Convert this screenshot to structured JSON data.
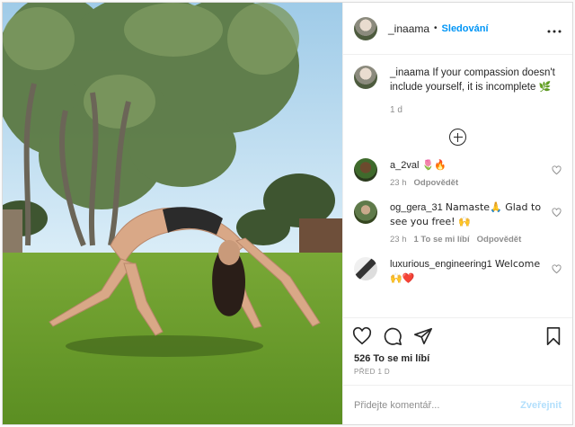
{
  "post": {
    "username": "_inaama",
    "follow_label": "Sledování",
    "dot": "•",
    "more_label": "...",
    "caption": {
      "username": "_inaama",
      "text": "If your compassion doesn't include yourself, it is incomplete",
      "emoji": "🌿",
      "time": "1 d"
    },
    "comments": [
      {
        "username": "a_2val",
        "text": "🌷🔥",
        "time": "23 h",
        "likes": "",
        "reply": "Odpovědět"
      },
      {
        "username": "og_gera_31",
        "text": "Namaste🙏 Glad to see you free! 🙌",
        "time": "23 h",
        "likes": "1 To se mi líbí",
        "reply": "Odpovědět"
      },
      {
        "username": "luxurious_engineering1",
        "text": "Welcome 🙌❤️",
        "time": "",
        "likes": "",
        "reply": ""
      }
    ],
    "likes_text": "526 To se mi líbí",
    "posted_ago": "PŘED 1 D",
    "comment_placeholder": "Přidejte komentář...",
    "publish_label": "Zveřejnit"
  },
  "icons": {
    "like": "heart-icon",
    "comment": "comment-icon",
    "share": "paper-plane-icon",
    "save": "bookmark-icon",
    "load_more": "plus-circle-icon"
  },
  "colors": {
    "link_blue": "#0095f6",
    "publish_disabled": "#b2dffc",
    "muted": "#8e8e8e"
  }
}
